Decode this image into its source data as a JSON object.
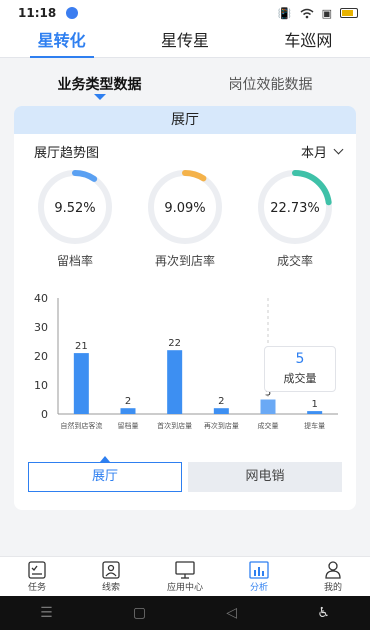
{
  "status": {
    "time": "11:18"
  },
  "top_tabs": [
    "星转化",
    "星传星",
    "车巡网"
  ],
  "sub_tabs": [
    "业务类型数据",
    "岗位效能数据"
  ],
  "card": {
    "header": "展厅",
    "trend_title": "展厅趋势图",
    "month": "本月"
  },
  "rings": [
    {
      "value": "9.52%",
      "label": "留档率",
      "fraction": 0.0952,
      "color": "#5aa0f2"
    },
    {
      "value": "9.09%",
      "label": "再次到店率",
      "fraction": 0.0909,
      "color": "#f4b24a"
    },
    {
      "value": "22.73%",
      "label": "成交率",
      "fraction": 0.2273,
      "color": "#3fc1a8"
    }
  ],
  "chart_data": {
    "type": "bar",
    "categories": [
      "自然到店客流",
      "留档量",
      "首次到店量",
      "再次到店量",
      "成交量",
      "提车量"
    ],
    "values": [
      21,
      2,
      22,
      2,
      5,
      1
    ],
    "ylim": [
      0,
      40
    ],
    "yticks": [
      0,
      10,
      20,
      30,
      40
    ],
    "color": "#3d8ff2",
    "highlight_color": "#6aa9f5"
  },
  "tooltip": {
    "value": "5",
    "label": "成交量"
  },
  "bottom_toggle": [
    "展厅",
    "网电销"
  ],
  "nav": [
    "任务",
    "线索",
    "应用中心",
    "分析",
    "我的"
  ]
}
